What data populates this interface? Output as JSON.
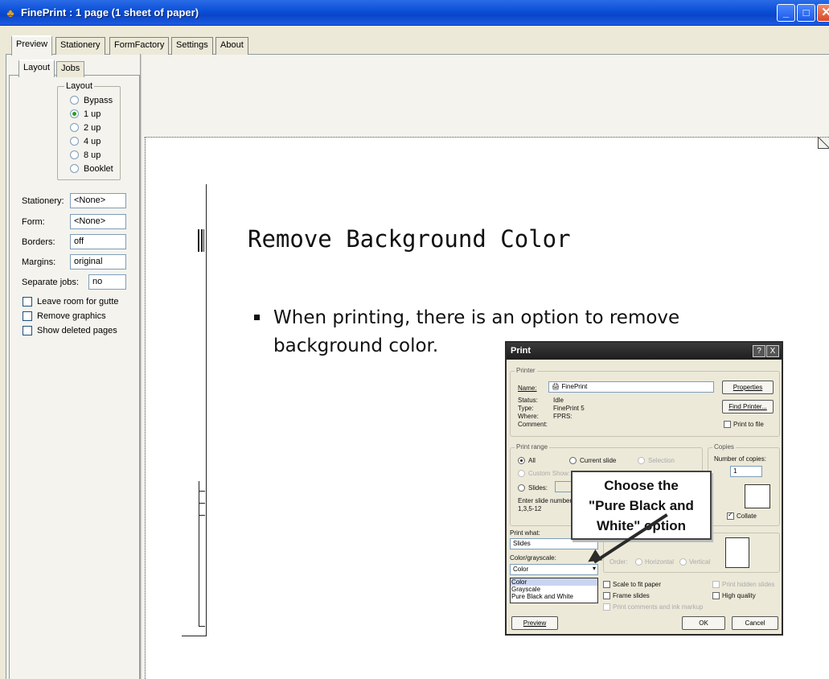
{
  "window": {
    "title": "FinePrint : 1 page (1 sheet of paper)",
    "app_icon": "fineprint-icon",
    "controls": {
      "minimize": "_",
      "maximize": "□",
      "close": "✕"
    }
  },
  "tabs": [
    "Preview",
    "Stationery",
    "FormFactory",
    "Settings",
    "About"
  ],
  "subtabs": [
    "Layout",
    "Jobs"
  ],
  "layout_group": {
    "title": "Layout",
    "options": [
      "Bypass",
      "1 up",
      "2 up",
      "4 up",
      "8 up",
      "Booklet"
    ],
    "selected": "1 up"
  },
  "fields": {
    "stationery": {
      "label": "Stationery:",
      "value": "<None>"
    },
    "form": {
      "label": "Form:",
      "value": "<None>"
    },
    "borders": {
      "label": "Borders:",
      "value": "off"
    },
    "margins": {
      "label": "Margins:",
      "value": "original"
    },
    "separate_jobs": {
      "label": "Separate jobs:",
      "value": "no"
    }
  },
  "checkboxes": [
    "Leave room for gutte",
    "Remove graphics",
    "Show deleted pages"
  ],
  "slide": {
    "title": "Remove Background Color",
    "bullet": "When printing, there is an option to remove background color.",
    "callout": [
      "Choose the",
      "\"Pure Black and",
      "White\" option"
    ]
  },
  "print_dialog": {
    "title": "Print",
    "title_buttons": {
      "help": "?",
      "close": "X"
    },
    "printer_group": "Printer",
    "name_label": "Name:",
    "printer_name": "FinePrint",
    "status_label": "Status:",
    "status": "Idle",
    "type_label": "Type:",
    "type": "FinePrint 5",
    "where_label": "Where:",
    "where": "FPRS:",
    "comment_label": "Comment:",
    "properties": "Properties",
    "find_printer": "Find Printer...",
    "print_to_file": "Print to file",
    "print_range": "Print range",
    "all": "All",
    "current_slide": "Current slide",
    "selection": "Selection",
    "custom_show": "Custom Show:",
    "slides": "Slides:",
    "enter_slide": "Enter slide number",
    "slide_example": "1,3,5-12",
    "copies": "Copies",
    "number_of_copies": "Number of copies:",
    "copies_value": "1",
    "collate": "Collate",
    "print_what": "Print what:",
    "print_what_value": "Slides",
    "color_grayscale": "Color/grayscale:",
    "color_value": "Color",
    "color_options": [
      "Color",
      "Grayscale",
      "Pure Black and White"
    ],
    "order": "Order:",
    "horizontal": "Horizontal",
    "vertical": "Vertical",
    "scale_to_fit": "Scale to fit paper",
    "frame_slides": "Frame slides",
    "print_comments": "Print comments and ink markup",
    "print_hidden": "Print hidden slides",
    "high_quality": "High quality",
    "preview": "Preview",
    "ok": "OK",
    "cancel": "Cancel"
  }
}
